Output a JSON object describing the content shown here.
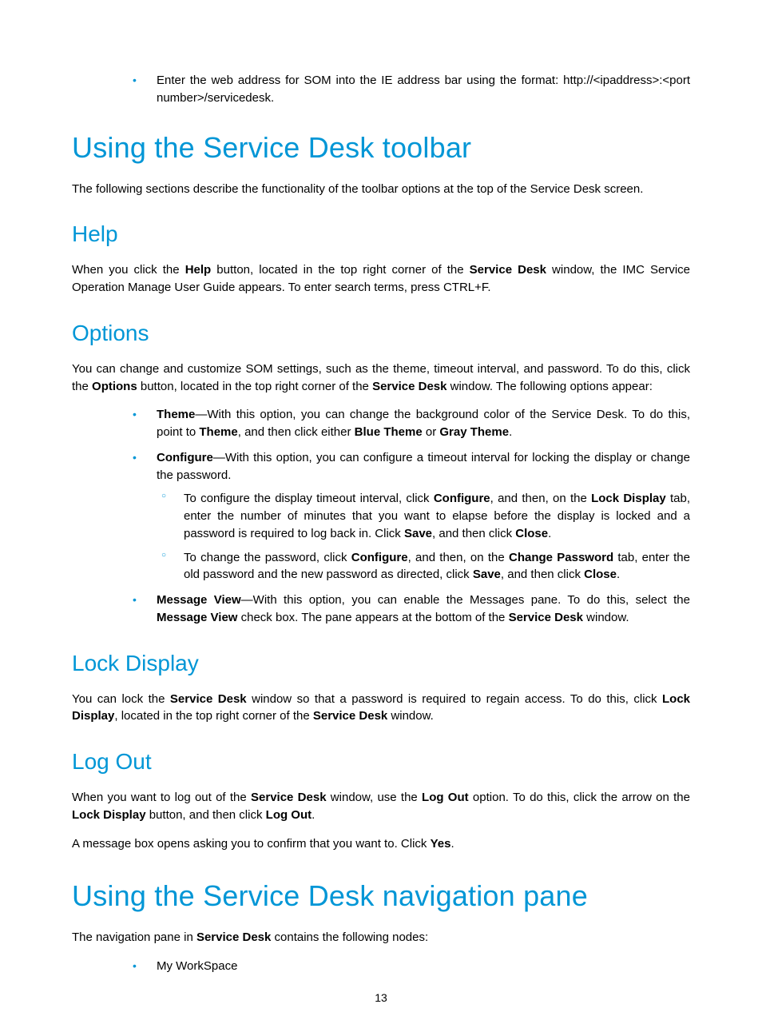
{
  "intro_bullet": {
    "text_a": "Enter the web address for SOM into the IE address bar using the format: http://<ipaddress>:<port number>/servicedesk."
  },
  "h1_toolbar": "Using the Service Desk toolbar",
  "p_toolbar_intro": "The following sections describe the functionality of the toolbar options at the top of the Service Desk screen.",
  "h2_help": "Help",
  "p_help": {
    "seg1": "When you click the ",
    "b1": "Help",
    "seg2": " button, located in the top right corner of the ",
    "b2": "Service Desk",
    "seg3": " window, the IMC Service Operation Manage User Guide appears. To enter search terms, press CTRL+F."
  },
  "h2_options": "Options",
  "p_options_intro": {
    "seg1": "You can change and customize SOM settings, such as the theme, timeout interval, and password. To do this, click the ",
    "b1": "Options",
    "seg2": " button, located in the top right corner of the ",
    "b2": "Service Desk",
    "seg3": " window. The following options appear:"
  },
  "opt_theme": {
    "b1": "Theme",
    "seg1": "—With this option, you can change the background color of the Service Desk. To do this, point to ",
    "b2": "Theme",
    "seg2": ", and then click either ",
    "b3": "Blue Theme",
    "seg3": " or ",
    "b4": "Gray Theme",
    "seg4": "."
  },
  "opt_configure": {
    "b1": "Configure",
    "seg1": "—With this option, you can configure a timeout interval for locking the display or change the password."
  },
  "opt_configure_sub1": {
    "seg1": "To configure the display timeout interval, click ",
    "b1": "Configure",
    "seg2": ", and then, on the ",
    "b2": "Lock Display",
    "seg3": " tab, enter the number of minutes that you want to elapse before the display is locked and a password is required to log back in. Click ",
    "b3": "Save",
    "seg4": ", and then click ",
    "b4": "Close",
    "seg5": "."
  },
  "opt_configure_sub2": {
    "seg1": "To change the password, click ",
    "b1": "Configure",
    "seg2": ", and then, on the ",
    "b2": "Change Password",
    "seg3": " tab, enter the old password and the new password as directed, click ",
    "b3": "Save",
    "seg4": ", and then click ",
    "b4": "Close",
    "seg5": "."
  },
  "opt_msgview": {
    "b1": "Message View",
    "seg1": "—With this option, you can enable the Messages pane. To do this, select the ",
    "b2": "Message View",
    "seg2": " check box. The pane appears at the bottom of the ",
    "b3": "Service Desk",
    "seg3": " window."
  },
  "h2_lock": "Lock Display",
  "p_lock": {
    "seg1": "You can lock the ",
    "b1": "Service Desk",
    "seg2": " window so that a password is required to regain access. To do this, click ",
    "b2": "Lock Display",
    "seg3": ", located in the top right corner of the ",
    "b3": "Service Desk",
    "seg4": " window."
  },
  "h2_logout": "Log Out",
  "p_logout1": {
    "seg1": "When you want to log out of the ",
    "b1": "Service Desk",
    "seg2": " window, use the ",
    "b2": "Log Out",
    "seg3": " option. To do this, click the arrow on the ",
    "b3": "Lock Display",
    "seg4": " button, and then click ",
    "b4": "Log Out",
    "seg5": "."
  },
  "p_logout2": {
    "seg1": "A message box opens asking you to confirm that you want to. Click ",
    "b1": "Yes",
    "seg2": "."
  },
  "h1_navpane": "Using the Service Desk navigation pane",
  "p_nav_intro": {
    "seg1": "The navigation pane in ",
    "b1": "Service Desk",
    "seg2": " contains the following nodes:"
  },
  "nav_item1": "My WorkSpace",
  "page_number": "13"
}
